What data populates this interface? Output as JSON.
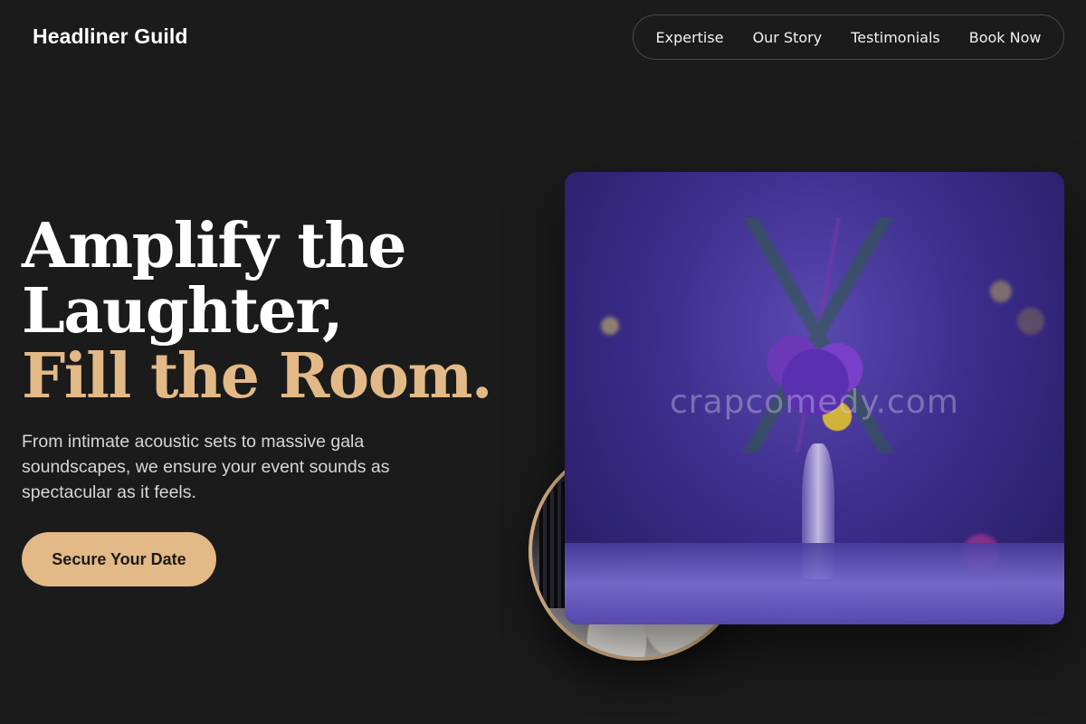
{
  "brand": {
    "name": "Headliner Guild"
  },
  "nav": {
    "items": [
      {
        "label": "Expertise"
      },
      {
        "label": "Our Story"
      },
      {
        "label": "Testimonials"
      },
      {
        "label": "Book Now"
      }
    ]
  },
  "hero": {
    "title_line_1": "Amplify the",
    "title_line_2": "Laughter,",
    "title_line_3": "Fill the Room.",
    "subtitle": "From intimate acoustic sets to massive gala soundscapes, we ensure your event sounds as spectacular as it feels.",
    "cta_label": "Secure Your Date"
  },
  "images": {
    "watermark_text": "crapcomedy.com"
  },
  "colors": {
    "background": "#1b1b1b",
    "accent": "#e3b987",
    "text_primary": "#ffffff",
    "text_secondary": "#d6d6d6",
    "nav_border": "#4a4a4a"
  }
}
